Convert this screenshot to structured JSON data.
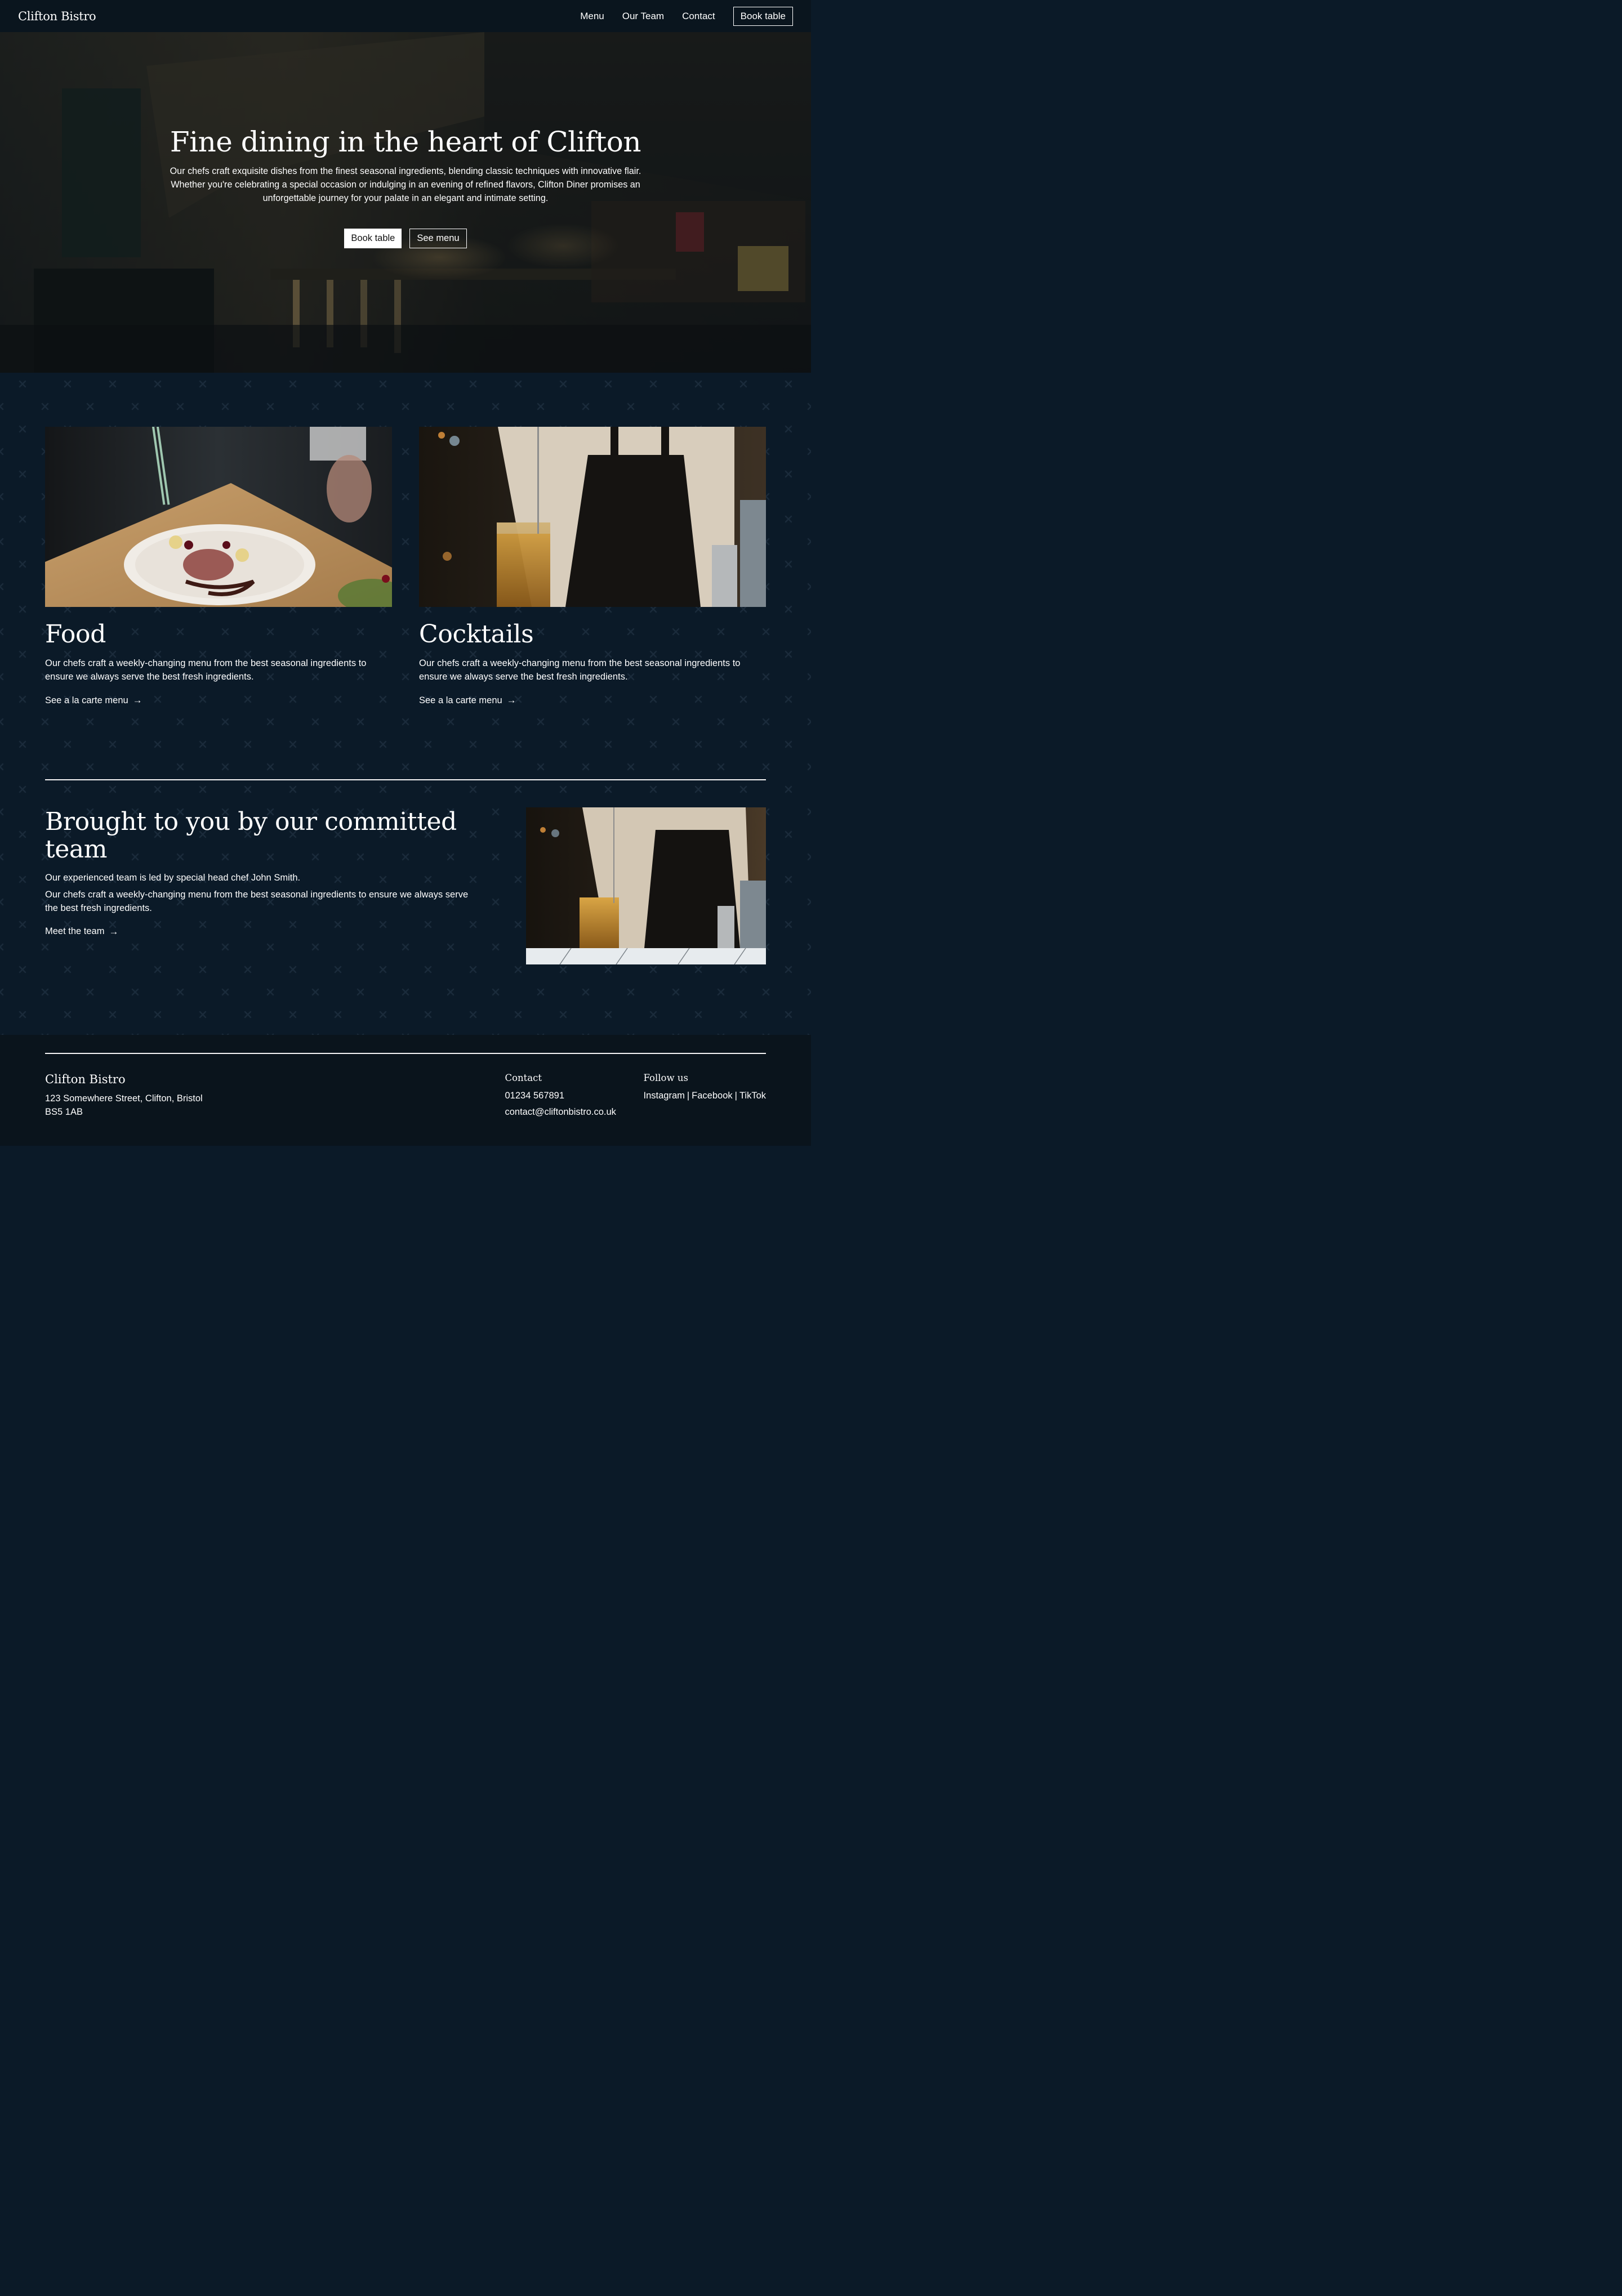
{
  "nav": {
    "brand": "Clifton Bistro",
    "links": [
      {
        "label": "Menu"
      },
      {
        "label": "Our Team"
      },
      {
        "label": "Contact"
      }
    ],
    "cta_label": "Book table"
  },
  "hero": {
    "title": "Fine dining in the heart of Clifton",
    "text": "Our chefs craft exquisite dishes from the finest seasonal ingredients, blending classic techniques with innovative flair. Whether you're celebrating a special occasion or indulging in an evening of refined flavors, Clifton Diner promises an unforgettable journey for your palate in an elegant and intimate setting.",
    "primary_button": "Book table",
    "secondary_button": "See menu",
    "image_alt": "restaurant-bar-interior-photo"
  },
  "cards": [
    {
      "title": "Food",
      "text": "Our chefs craft a weekly-changing menu from the best seasonal ingredients to ensure we always serve the best fresh ingredients.",
      "link_label": "See a la carte menu",
      "image_alt": "plated-dish-photo"
    },
    {
      "title": "Cocktails",
      "text": "Our chefs craft a weekly-changing menu from the best seasonal ingredients to ensure we always serve the best fresh ingredients.",
      "link_label": "See a la carte menu",
      "image_alt": "bartender-stirring-cocktail-photo"
    }
  ],
  "team": {
    "title": "Brought to you by our committed team",
    "p1": "Our experienced team is led by special head chef John Smith.",
    "p2": "Our chefs craft a weekly-changing menu from the best seasonal ingredients to ensure we always serve the best fresh ingredients.",
    "link_label": "Meet the team",
    "image_alt": "bartender-photo"
  },
  "footer": {
    "brand": "Clifton Bistro",
    "address_line1": "123 Somewhere Street, Clifton, Bristol",
    "address_line2": "BS5 1AB",
    "contact_title": "Contact",
    "phone": "01234 567891",
    "email": "contact@cliftonbistro.co.uk",
    "follow_title": "Follow us",
    "social": [
      "Instagram",
      "Facebook",
      "TikTok"
    ],
    "separator": "|"
  },
  "icons": {
    "arrow": "→"
  },
  "colors": {
    "nav_bg": "#0a151e",
    "main_bg": "#0b1a28",
    "footer_bg": "#0a141c",
    "text": "#ffffff"
  }
}
